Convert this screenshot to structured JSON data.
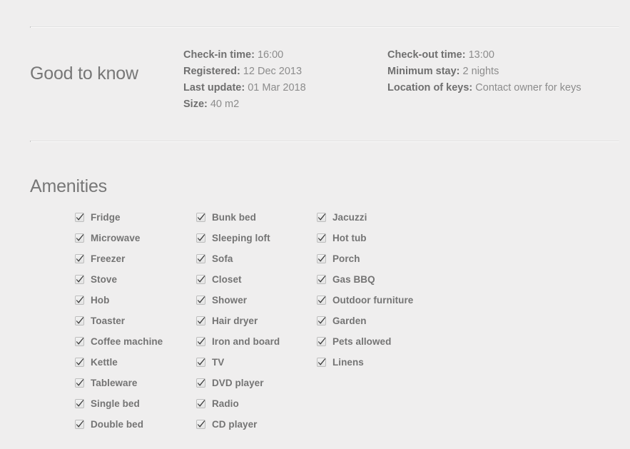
{
  "good_to_know": {
    "heading": "Good to know",
    "column_a": [
      {
        "label": "Check-in time:",
        "value": "16:00"
      },
      {
        "label": "Registered:",
        "value": "12 Dec 2013"
      },
      {
        "label": "Last update:",
        "value": "01 Mar 2018"
      },
      {
        "label": "Size:",
        "value": "40 m2"
      }
    ],
    "column_b": [
      {
        "label": "Check-out time:",
        "value": "13:00"
      },
      {
        "label": "Minimum stay:",
        "value": "2 nights"
      },
      {
        "label": "Location of keys:",
        "value": "Contact owner for keys"
      }
    ]
  },
  "amenities": {
    "heading": "Amenities",
    "checkbox_icon": "checkmark-icon",
    "columns": [
      {
        "items": [
          {
            "label": "Fridge",
            "checked": true
          },
          {
            "label": "Microwave",
            "checked": true
          },
          {
            "label": "Freezer",
            "checked": true
          },
          {
            "label": "Stove",
            "checked": true
          },
          {
            "label": "Hob",
            "checked": true
          },
          {
            "label": "Toaster",
            "checked": true
          },
          {
            "label": "Coffee machine",
            "checked": true
          },
          {
            "label": "Kettle",
            "checked": true
          },
          {
            "label": "Tableware",
            "checked": true
          },
          {
            "label": "Single bed",
            "checked": true
          },
          {
            "label": "Double bed",
            "checked": true
          }
        ]
      },
      {
        "items": [
          {
            "label": "Bunk bed",
            "checked": true
          },
          {
            "label": "Sleeping loft",
            "checked": true
          },
          {
            "label": "Sofa",
            "checked": true
          },
          {
            "label": "Closet",
            "checked": true
          },
          {
            "label": "Shower",
            "checked": true
          },
          {
            "label": "Hair dryer",
            "checked": true
          },
          {
            "label": "Iron and board",
            "checked": true
          },
          {
            "label": "TV",
            "checked": true
          },
          {
            "label": "DVD player",
            "checked": true
          },
          {
            "label": "Radio",
            "checked": true
          },
          {
            "label": "CD player",
            "checked": true
          }
        ]
      },
      {
        "items": [
          {
            "label": "Jacuzzi",
            "checked": true
          },
          {
            "label": "Hot tub",
            "checked": true
          },
          {
            "label": "Porch",
            "checked": true
          },
          {
            "label": "Gas BBQ",
            "checked": true
          },
          {
            "label": "Outdoor furniture",
            "checked": true
          },
          {
            "label": "Garden",
            "checked": true
          },
          {
            "label": "Pets allowed",
            "checked": true
          },
          {
            "label": "Linens",
            "checked": true
          }
        ]
      }
    ]
  },
  "colors": {
    "background": "#efeeee",
    "heading_text": "#777777",
    "label_text": "#6f6f6f",
    "value_text": "#8c8c8c",
    "divider": "#e2e2e2"
  }
}
